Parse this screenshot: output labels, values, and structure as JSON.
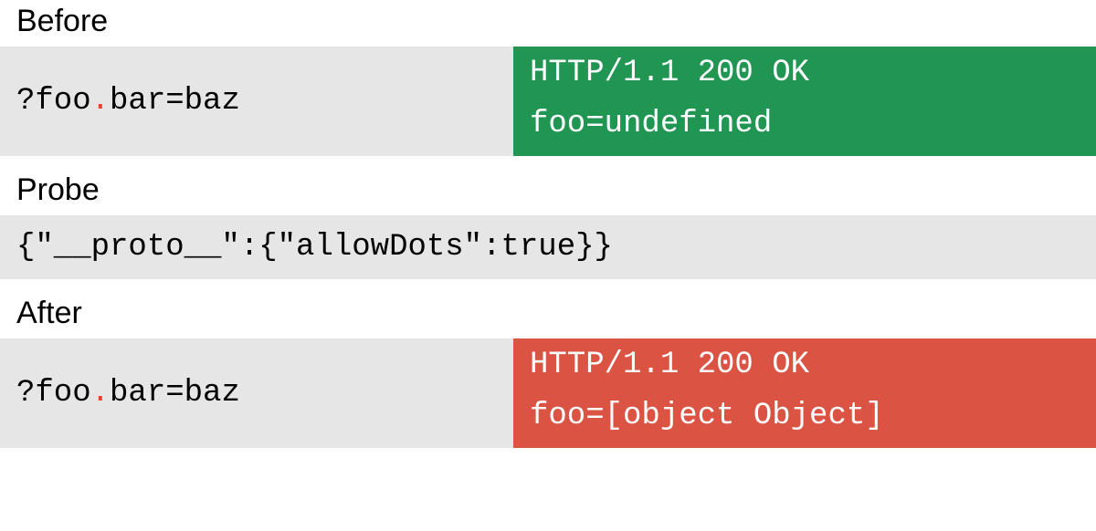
{
  "labels": {
    "before": "Before",
    "probe": "Probe",
    "after": "After"
  },
  "before": {
    "request_prefix": "?foo",
    "request_dot": ".",
    "request_suffix": "bar=baz",
    "response_status": "HTTP/1.1 200 OK",
    "response_body": "foo=undefined"
  },
  "probe": {
    "payload": "{\"__proto__\":{\"allowDots\":true}}"
  },
  "after": {
    "request_prefix": "?foo",
    "request_dot": ".",
    "request_suffix": "bar=baz",
    "response_status": "HTTP/1.1 200 OK",
    "response_body": "foo=[object Object]"
  },
  "colors": {
    "grey": "#e6e6e6",
    "green": "#219653",
    "red": "#da5343",
    "dot": "#e6432c"
  }
}
